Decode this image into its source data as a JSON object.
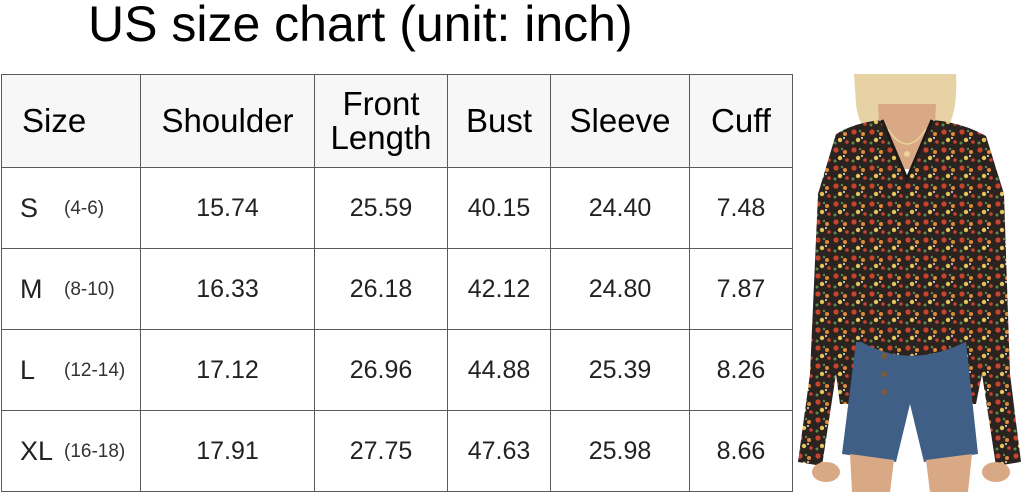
{
  "title": "US size chart (unit: inch)",
  "table": {
    "headers": [
      {
        "line1": "Size",
        "line2": ""
      },
      {
        "line1": "Shoulder",
        "line2": ""
      },
      {
        "line1": "Front",
        "line2": "Length"
      },
      {
        "line1": "Bust",
        "line2": ""
      },
      {
        "line1": "Sleeve",
        "line2": ""
      },
      {
        "line1": "Cuff",
        "line2": ""
      }
    ],
    "rows": [
      {
        "size": "S",
        "range": "(4-6)",
        "shoulder": "15.74",
        "front_length": "25.59",
        "bust": "40.15",
        "sleeve": "24.40",
        "cuff": "7.48"
      },
      {
        "size": "M",
        "range": "(8-10)",
        "shoulder": "16.33",
        "front_length": "26.18",
        "bust": "42.12",
        "sleeve": "24.80",
        "cuff": "7.87"
      },
      {
        "size": "L",
        "range": "(12-14)",
        "shoulder": "17.12",
        "front_length": "26.96",
        "bust": "44.88",
        "sleeve": "25.39",
        "cuff": "8.26"
      },
      {
        "size": "XL",
        "range": "(16-18)",
        "shoulder": "17.91",
        "front_length": "27.75",
        "bust": "47.63",
        "sleeve": "25.98",
        "cuff": "8.66"
      }
    ]
  },
  "photo": {
    "icon": "model-photo",
    "colors": {
      "background": "#ffffff",
      "skin": "#d9a884",
      "hair": "#e6d2a4",
      "blouse_base": "#2a2320",
      "flower_red": "#c8432e",
      "flower_orange": "#e08a3a",
      "flower_yellow": "#e6c55a",
      "flower_green": "#5f8a4a",
      "denim": "#3f5f86"
    }
  }
}
